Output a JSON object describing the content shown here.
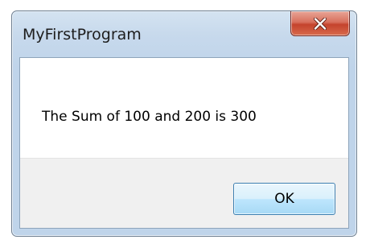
{
  "window": {
    "title": "MyFirstProgram",
    "close_icon": "close-icon"
  },
  "message": {
    "text": "The Sum of 100 and 200 is 300"
  },
  "buttons": {
    "ok_label": "OK"
  },
  "colors": {
    "close_button": "#c94a34",
    "ok_button_border": "#3c7fb1",
    "frame": "#bfd4ea"
  }
}
